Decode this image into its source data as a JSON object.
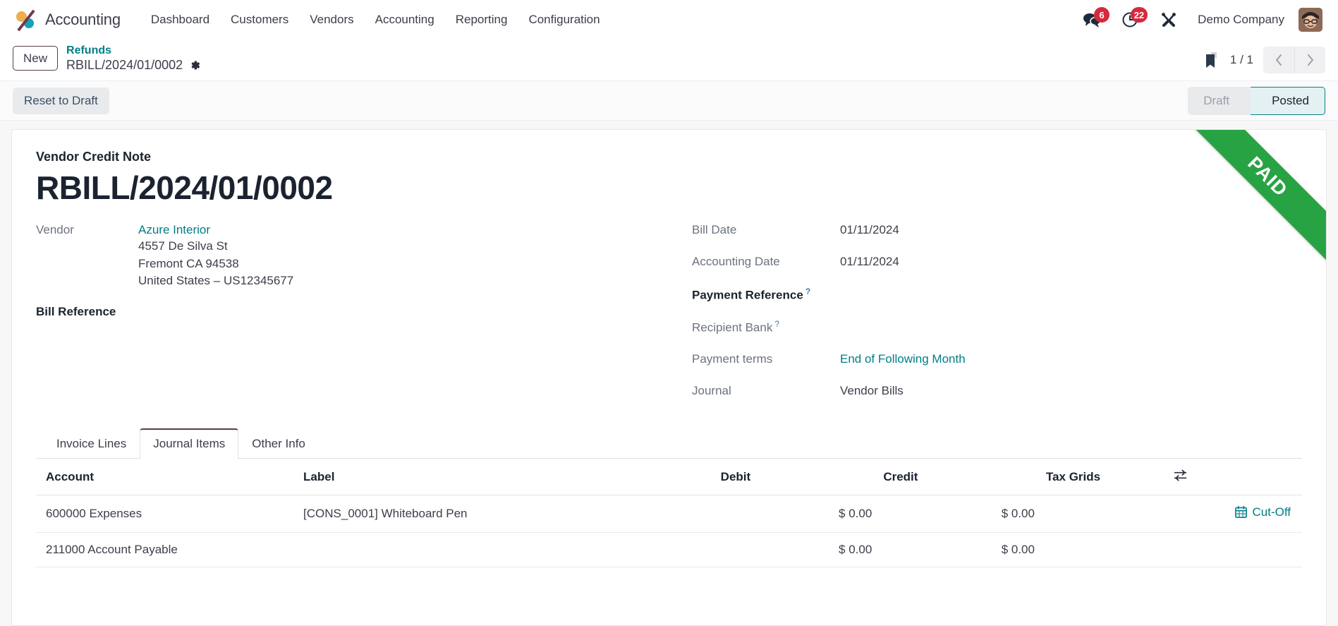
{
  "navbar": {
    "brand": "Accounting",
    "logo_icon": "odoo-logo-icon",
    "menu": [
      "Dashboard",
      "Customers",
      "Vendors",
      "Accounting",
      "Reporting",
      "Configuration"
    ],
    "systray": {
      "messages_icon": "chat-bubble-icon",
      "messages_count": "6",
      "activities_icon": "clock-icon",
      "activities_count": "22",
      "debug_icon": "tools-wrench-icon",
      "company": "Demo Company",
      "avatar_icon": "user-avatar-icon"
    }
  },
  "control_panel": {
    "new_label": "New",
    "breadcrumb_parent": "Refunds",
    "breadcrumb_current": "RBILL/2024/01/0002",
    "settings_icon": "gear-icon",
    "attachment_icon": "bookmark-icon",
    "pager": "1 / 1",
    "prev_icon": "chevron-left-icon",
    "next_icon": "chevron-right-icon"
  },
  "statusbar": {
    "reset_label": "Reset to Draft",
    "steps": [
      {
        "label": "Draft",
        "active": false
      },
      {
        "label": "Posted",
        "active": true
      }
    ]
  },
  "sheet": {
    "ribbon": "PAID",
    "ribbon_color": "#28a344",
    "doc_type": "Vendor Credit Note",
    "doc_title": "RBILL/2024/01/0002",
    "left_fields": {
      "vendor_label": "Vendor",
      "vendor_name": "Azure Interior",
      "vendor_address": [
        "4557 De Silva St",
        "Fremont CA 94538",
        "United States – US12345677"
      ],
      "bill_reference_label": "Bill Reference",
      "bill_reference_value": ""
    },
    "right_fields": [
      {
        "label": "Bill Date",
        "value": "01/11/2024",
        "strong": false,
        "help": false,
        "link": false
      },
      {
        "label": "Accounting Date",
        "value": "01/11/2024",
        "strong": false,
        "help": false,
        "link": false
      },
      {
        "label": "Payment Reference",
        "value": "",
        "strong": true,
        "help": true,
        "link": false
      },
      {
        "label": "Recipient Bank",
        "value": "",
        "strong": false,
        "help": true,
        "link": false
      },
      {
        "label": "Payment terms",
        "value": "End of Following Month",
        "strong": false,
        "help": false,
        "link": true
      },
      {
        "label": "Journal",
        "value": "Vendor Bills",
        "strong": false,
        "help": false,
        "link": false
      }
    ]
  },
  "notebook": {
    "tabs": [
      {
        "label": "Invoice Lines",
        "active": false
      },
      {
        "label": "Journal Items",
        "active": true
      },
      {
        "label": "Other Info",
        "active": false
      }
    ]
  },
  "lines": {
    "headers": {
      "account": "Account",
      "label": "Label",
      "debit": "Debit",
      "credit": "Credit",
      "tax_grids": "Tax Grids",
      "options_icon": "column-options-icon"
    },
    "rows": [
      {
        "account": "600000 Expenses",
        "label": "[CONS_0001] Whiteboard Pen",
        "debit": "$ 0.00",
        "credit": "$ 0.00",
        "tax_grids": "",
        "cutoff_label": "Cut-Off",
        "cutoff_icon": "calendar-icon",
        "has_cutoff": true
      },
      {
        "account": "211000 Account Payable",
        "label": "",
        "debit": "$ 0.00",
        "credit": "$ 0.00",
        "tax_grids": "",
        "cutoff_label": "",
        "cutoff_icon": "",
        "has_cutoff": false
      }
    ]
  },
  "colors": {
    "link_teal": "#017e84",
    "badge_red": "#d6293e",
    "brand_purple": "#5a3c52",
    "paid_green": "#28a344"
  }
}
